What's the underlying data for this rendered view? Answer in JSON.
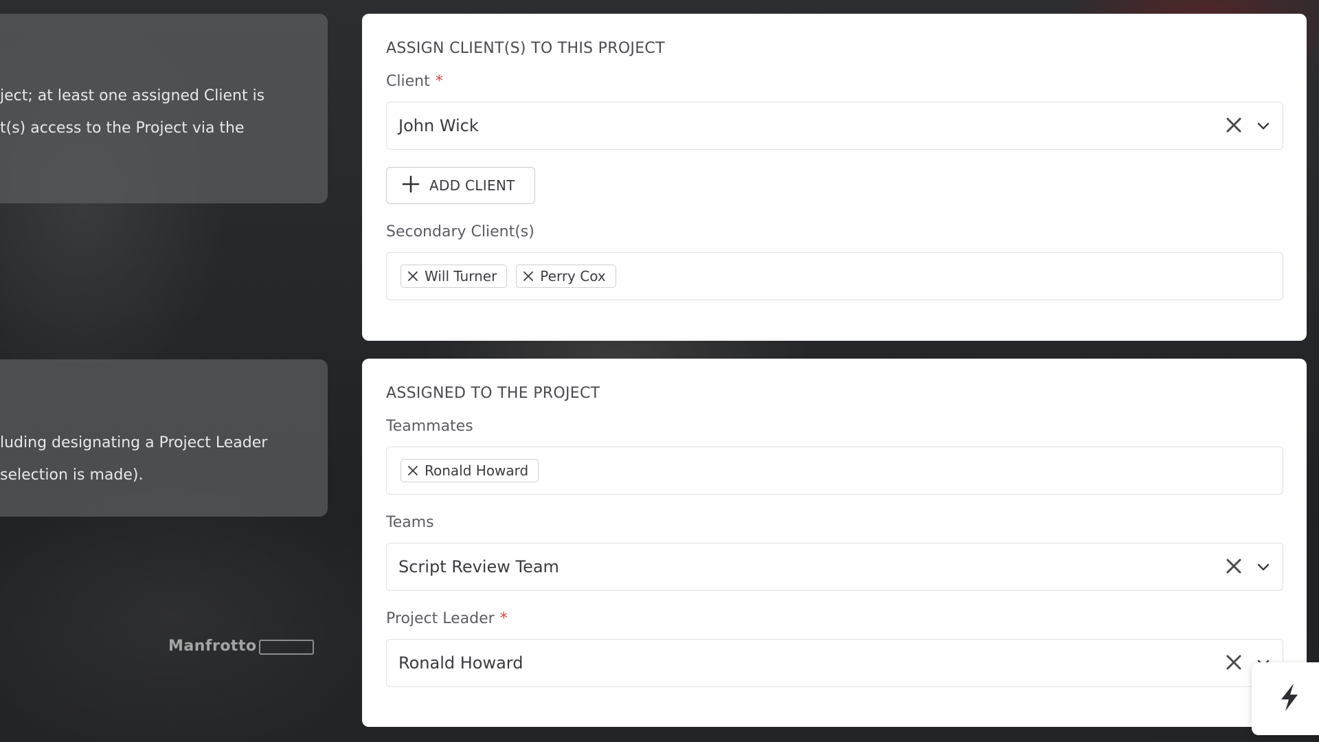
{
  "background": {
    "brand_text": "Manfrotto"
  },
  "info_cards": [
    {
      "lines": [
        "ject; at least one assigned Client is",
        "t(s) access to the Project via the"
      ]
    },
    {
      "lines": [
        "luding designating a Project Leader",
        "selection is made)."
      ]
    }
  ],
  "client_section": {
    "title": "ASSIGN CLIENT(S) TO THIS PROJECT",
    "client_label": "Client",
    "required_mark": "*",
    "client_value": "John Wick",
    "add_client_label": "ADD CLIENT",
    "secondary_label": "Secondary Client(s)",
    "secondary_clients": [
      "Will Turner",
      "Perry Cox"
    ]
  },
  "assigned_section": {
    "title": "ASSIGNED TO THE PROJECT",
    "teammates_label": "Teammates",
    "teammates": [
      "Ronald Howard"
    ],
    "teams_label": "Teams",
    "teams_value": "Script Review Team",
    "leader_label": "Project Leader",
    "required_mark": "*",
    "leader_value": "Ronald Howard"
  },
  "icons": {
    "clear": "close-icon",
    "chevron": "chevron-down-icon",
    "add": "plus-icon",
    "fab": "lightning-bolt-icon"
  },
  "colors": {
    "required": "#d64545",
    "text": "#3b3b40",
    "border": "#e1e2e6"
  }
}
